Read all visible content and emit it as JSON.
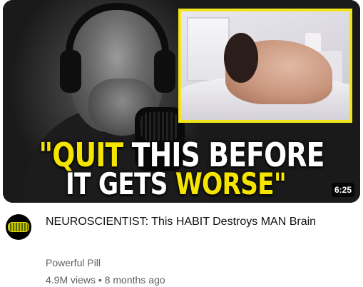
{
  "video": {
    "thumbnail_text_line1_part1": "\"QUIT",
    "thumbnail_text_line1_part2": " THIS BEFORE",
    "thumbnail_text_line2_part1": "IT GETS ",
    "thumbnail_text_line2_part2": "WORSE\"",
    "duration": "6:25",
    "title": "NEUROSCIENTIST: This HABIT Destroys MAN Brain",
    "channel": "Powerful Pill",
    "views": "4.9M views",
    "separator": " • ",
    "age": "8 months ago"
  },
  "colors": {
    "highlight_yellow": "#f5e400",
    "inset_border": "#f2e41a",
    "secondary_text": "#606060"
  }
}
